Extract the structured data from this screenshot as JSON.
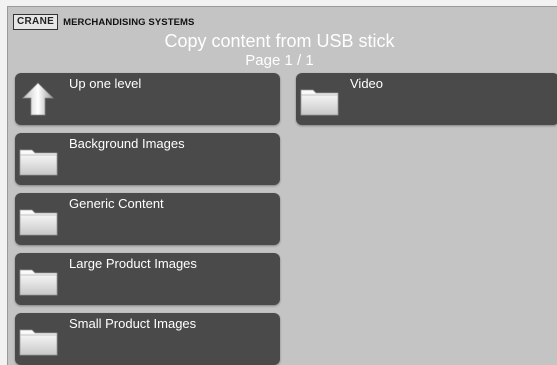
{
  "brand": {
    "logo": "CRANE",
    "name": "MERCHANDISING SYSTEMS"
  },
  "header": {
    "title": "Copy content from USB stick",
    "page": "Page 1 / 1"
  },
  "items": [
    {
      "label": "Up one level",
      "icon": "up-arrow-icon"
    },
    {
      "label": "Background Images",
      "icon": "folder-icon"
    },
    {
      "label": "Generic Content",
      "icon": "folder-icon"
    },
    {
      "label": "Large Product Images",
      "icon": "folder-icon"
    },
    {
      "label": "Small Product Images",
      "icon": "folder-icon"
    },
    {
      "label": "Video",
      "icon": "folder-icon"
    }
  ]
}
